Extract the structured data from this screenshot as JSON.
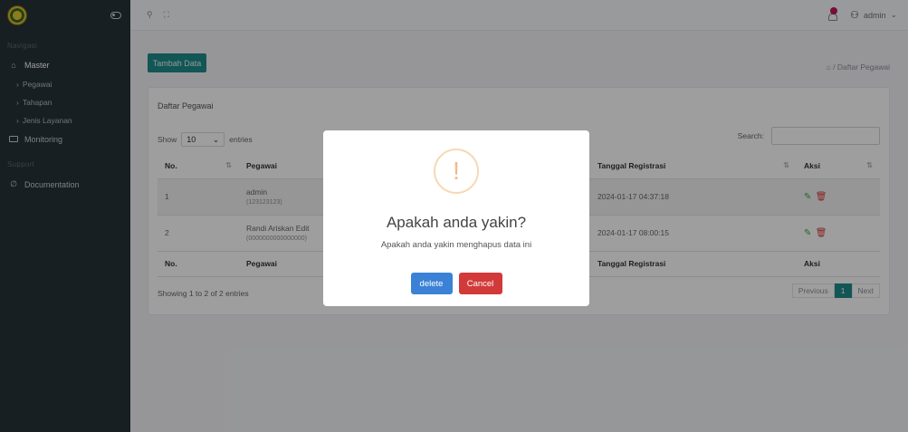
{
  "sidebar": {
    "section_nav": "Navigasi",
    "master_label": "Master",
    "items": [
      "Pegawai",
      "Tahapan",
      "Jenis Layanan"
    ],
    "monitoring_label": "Monitoring",
    "section_support": "Support",
    "documentation_label": "Documentation"
  },
  "topbar": {
    "user_name": "admin",
    "search_icon": "search-icon",
    "expand_icon": "expand-icon",
    "notification_color": "#c2185b"
  },
  "content": {
    "add_button": "Tambah Data",
    "breadcrumb": "⌂ / Daftar Pegawai",
    "card_title": "Daftar Pegawai",
    "show_label": "Show",
    "entries_value": "10",
    "entries_label": "entries",
    "search_label": "Search:",
    "search_value": "",
    "columns": [
      "No.",
      "Pegawai",
      "Tanggal Registrasi",
      "Aksi"
    ],
    "rows": [
      {
        "no": "1",
        "name": "admin",
        "nip": "(123123123)",
        "date": "2024-01-17 04:37:18"
      },
      {
        "no": "2",
        "name": "Randi Ariskan Edit",
        "nip": "(0000000000000000)",
        "date": "2024-01-17 08:00:15"
      }
    ],
    "info": "Showing 1 to 2 of 2 entries",
    "pager": {
      "prev": "Previous",
      "page": "1",
      "next": "Next"
    },
    "accent_color": "#1e8c8c"
  },
  "modal": {
    "icon": "!",
    "title": "Apakah anda yakin?",
    "text": "Apakah anda yakin menghapus data ini",
    "delete_label": "delete",
    "cancel_label": "Cancel",
    "delete_color": "#3b82d6",
    "cancel_color": "#d23a3a"
  }
}
